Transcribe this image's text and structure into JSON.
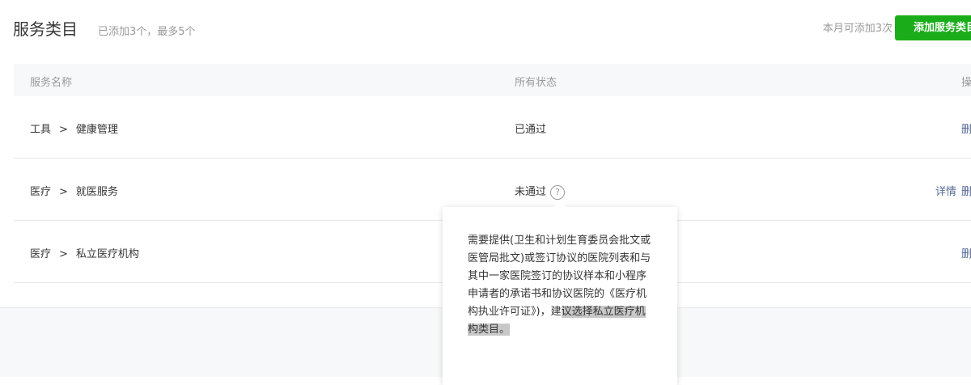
{
  "header": {
    "title": "服务类目",
    "subtitle": "已添加3个，最多5个",
    "quota_text": "本月可添加3次",
    "add_button": "添加服务类目"
  },
  "table": {
    "columns": [
      "服务名称",
      "所有状态",
      "操作"
    ],
    "rows": [
      {
        "category": "工具",
        "sep": ">",
        "subcategory": "健康管理",
        "status": "已通过",
        "action": "删除"
      },
      {
        "category": "医疗",
        "sep": ">",
        "subcategory": "就医服务",
        "status": "未通过",
        "detail": "详情",
        "action": "删除"
      },
      {
        "category": "医疗",
        "sep": ">",
        "subcategory": "私立医疗机构",
        "status": "",
        "action": "删除"
      }
    ]
  },
  "tooltip": {
    "text_main": "需要提供(卫生和计划生育委员会批文或医管局批文)或签订协议的医院列表和与其中一家医院签订的协议样本和小程序申请者的承诺书和协议医院的《医疗机构执业许可证》)，建",
    "text_highlight": "议选择私立医疗机构类目。"
  },
  "icons": {
    "help": "?"
  },
  "colors": {
    "accent": "#1aad19",
    "link": "#576b95"
  }
}
